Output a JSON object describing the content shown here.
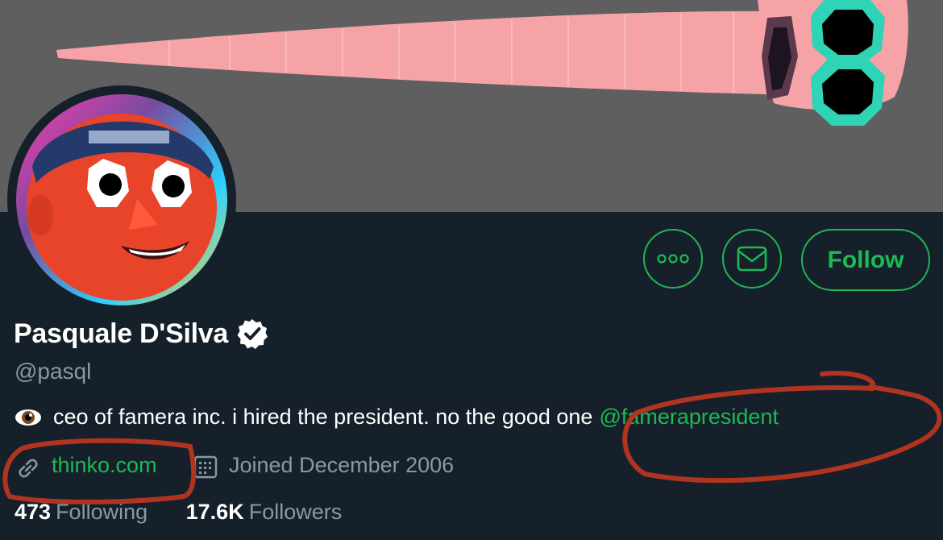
{
  "profile": {
    "display_name": "Pasquale D'Silva",
    "handle": "@pasql",
    "bio_icon": "eye-emoji",
    "bio_text": "ceo of famera inc. i hired the president. no the good one",
    "bio_mention": "@famerapresident",
    "website": "thinko.com",
    "joined": "Joined December 2006"
  },
  "actions": {
    "more_icon": "ellipsis-icon",
    "message_icon": "envelope-icon",
    "follow_label": "Follow"
  },
  "stats": {
    "following_count": "473",
    "following_label": "Following",
    "followers_count": "17.6K",
    "followers_label": "Followers"
  },
  "colors": {
    "background": "#15202b",
    "banner": "#5f5f5f",
    "accent": "#1db954",
    "muted_text": "#8899a6",
    "annotation": "#b0341f"
  },
  "annotations": [
    "circle-around-website",
    "circle-around-mention"
  ]
}
